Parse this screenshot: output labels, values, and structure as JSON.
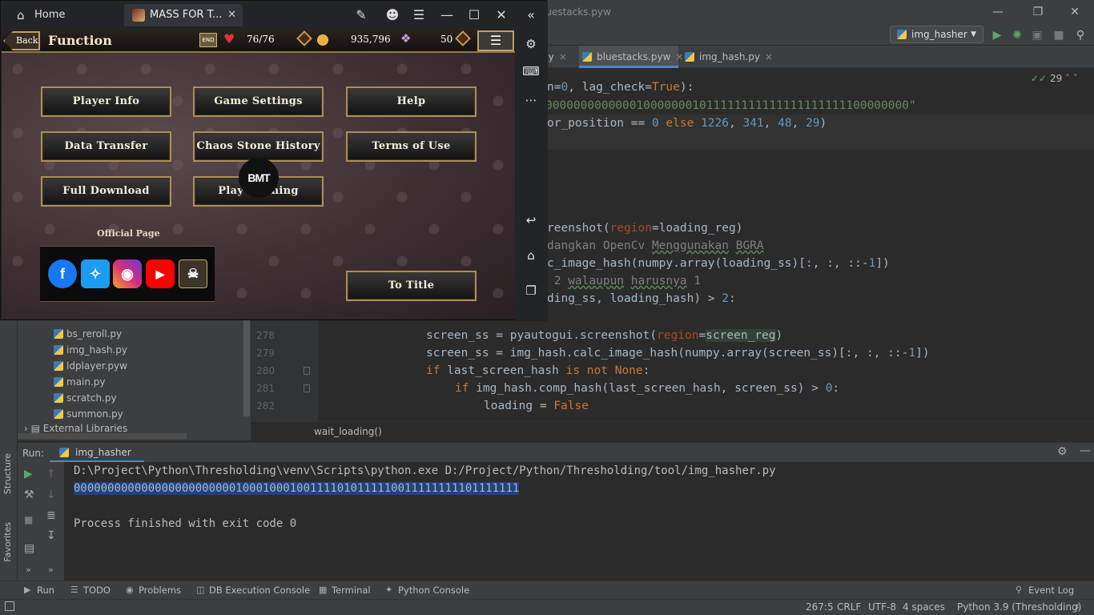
{
  "emulator": {
    "home_label": "Home",
    "tab_label": "MASS FOR T...",
    "game": {
      "back_label": "Back",
      "title": "Function",
      "stamina": "76/76",
      "gold": "935,796",
      "gems": "50",
      "buttons": [
        "Player Info",
        "Game Settings",
        "Help",
        "Data Transfer",
        "Chaos Stone History",
        "Terms of Use",
        "Full Download",
        "Play Opening"
      ],
      "official_page": "Official Page",
      "to_title": "To Title",
      "watermark": "BMT"
    }
  },
  "ide": {
    "window_title": "luestacks.pyw",
    "run_config": "img_hasher",
    "tabs": [
      "py",
      "bluestacks.pyw",
      "img_hash.py"
    ],
    "inspection_count": "29",
    "code_top": [
      {
        "t": "n=0, lag_check=True):"
      },
      {
        "t": "0000000000000100000001011111111111111111111100000000\""
      },
      {
        "t": "or_position == 0 else 1226, 341, 48, 29)"
      },
      {
        "t": ""
      },
      {
        "t": ""
      },
      {
        "t": ""
      },
      {
        "t": ""
      },
      {
        "t": "reenshot(region=loading_reg)"
      },
      {
        "t": "dangkan OpenCv Menggunakan BGRA"
      },
      {
        "t": "c_image_hash(numpy.array(loading_ss)[:, :, ::-1])"
      },
      {
        "t": " 2 walaupun harusnya 1"
      },
      {
        "t": "ding_ss, loading_hash) > 2:"
      }
    ],
    "line_numbers": [
      "278",
      "279",
      "280",
      "281",
      "282"
    ],
    "code_bottom": [
      "screen_ss = pyautogui.screenshot(region=screen_reg)",
      "screen_ss = img_hash.calc_image_hash(numpy.array(screen_ss)[:, :, ::-1])",
      "if last_screen_hash is not None:",
      "    if img_hash.comp_hash(last_screen_hash, screen_ss) > 0:",
      "        loading = False"
    ],
    "breadcrumb": "wait_loading()",
    "project_files": [
      "bs_reroll.py",
      "img_hash.py",
      "ldplayer.pyw",
      "main.py",
      "scratch.py",
      "summon.py"
    ],
    "external_libraries": "External Libraries",
    "run_label": "Run:",
    "run_tab": "img_hasher",
    "console": {
      "cmd": "D:\\Project\\Python\\Thresholding\\venv\\Scripts\\python.exe D:/Project/Python/Thresholding/tool/img_hasher.py",
      "hash": "000000000000000000000000100010001001111010111110011111111101111111",
      "exit": "Process finished with exit code 0"
    },
    "side_labels": {
      "structure": "Structure",
      "favorites": "Favorites"
    },
    "tool_tabs": [
      "Run",
      "TODO",
      "Problems",
      "DB Execution Console",
      "Terminal",
      "Python Console"
    ],
    "event_log": "Event Log",
    "status": {
      "pos": "267:5",
      "eol": "CRLF",
      "enc": "UTF-8",
      "indent": "4 spaces",
      "interp": "Python 3.9 (Thresholding)"
    }
  }
}
